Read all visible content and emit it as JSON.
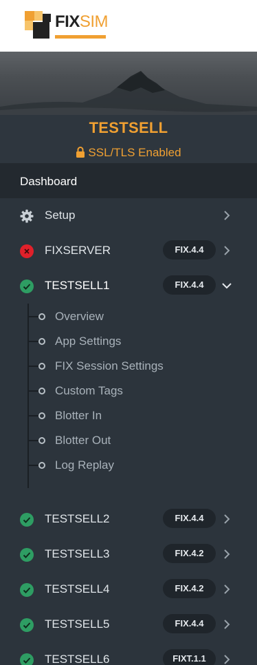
{
  "logo": {
    "word_fix": "FIX",
    "word_sim": "SIM"
  },
  "account": {
    "name": "TESTSELL",
    "ssl_label": "SSL/TLS Enabled",
    "accent_color": "#f0a032"
  },
  "dashboard": {
    "label": "Dashboard"
  },
  "setup": {
    "label": "Setup",
    "icon": "gear-icon"
  },
  "sessions": [
    {
      "name": "FIXSERVER",
      "version": "FIX.4.4",
      "status": "error",
      "expanded": false
    },
    {
      "name": "TESTSELL1",
      "version": "FIX.4.4",
      "status": "ok",
      "expanded": true
    },
    {
      "name": "TESTSELL2",
      "version": "FIX.4.4",
      "status": "ok",
      "expanded": false
    },
    {
      "name": "TESTSELL3",
      "version": "FIX.4.2",
      "status": "ok",
      "expanded": false
    },
    {
      "name": "TESTSELL4",
      "version": "FIX.4.2",
      "status": "ok",
      "expanded": false
    },
    {
      "name": "TESTSELL5",
      "version": "FIX.4.4",
      "status": "ok",
      "expanded": false
    },
    {
      "name": "TESTSELL6",
      "version": "FIXT.1.1",
      "status": "ok",
      "expanded": false
    }
  ],
  "submenu": [
    {
      "label": "Overview"
    },
    {
      "label": "App Settings"
    },
    {
      "label": "FIX Session Settings"
    },
    {
      "label": "Custom Tags"
    },
    {
      "label": "Blotter In"
    },
    {
      "label": "Blotter Out"
    },
    {
      "label": "Log Replay"
    }
  ],
  "colors": {
    "status_ok": "#2e9d63",
    "status_error": "#e0202a"
  }
}
